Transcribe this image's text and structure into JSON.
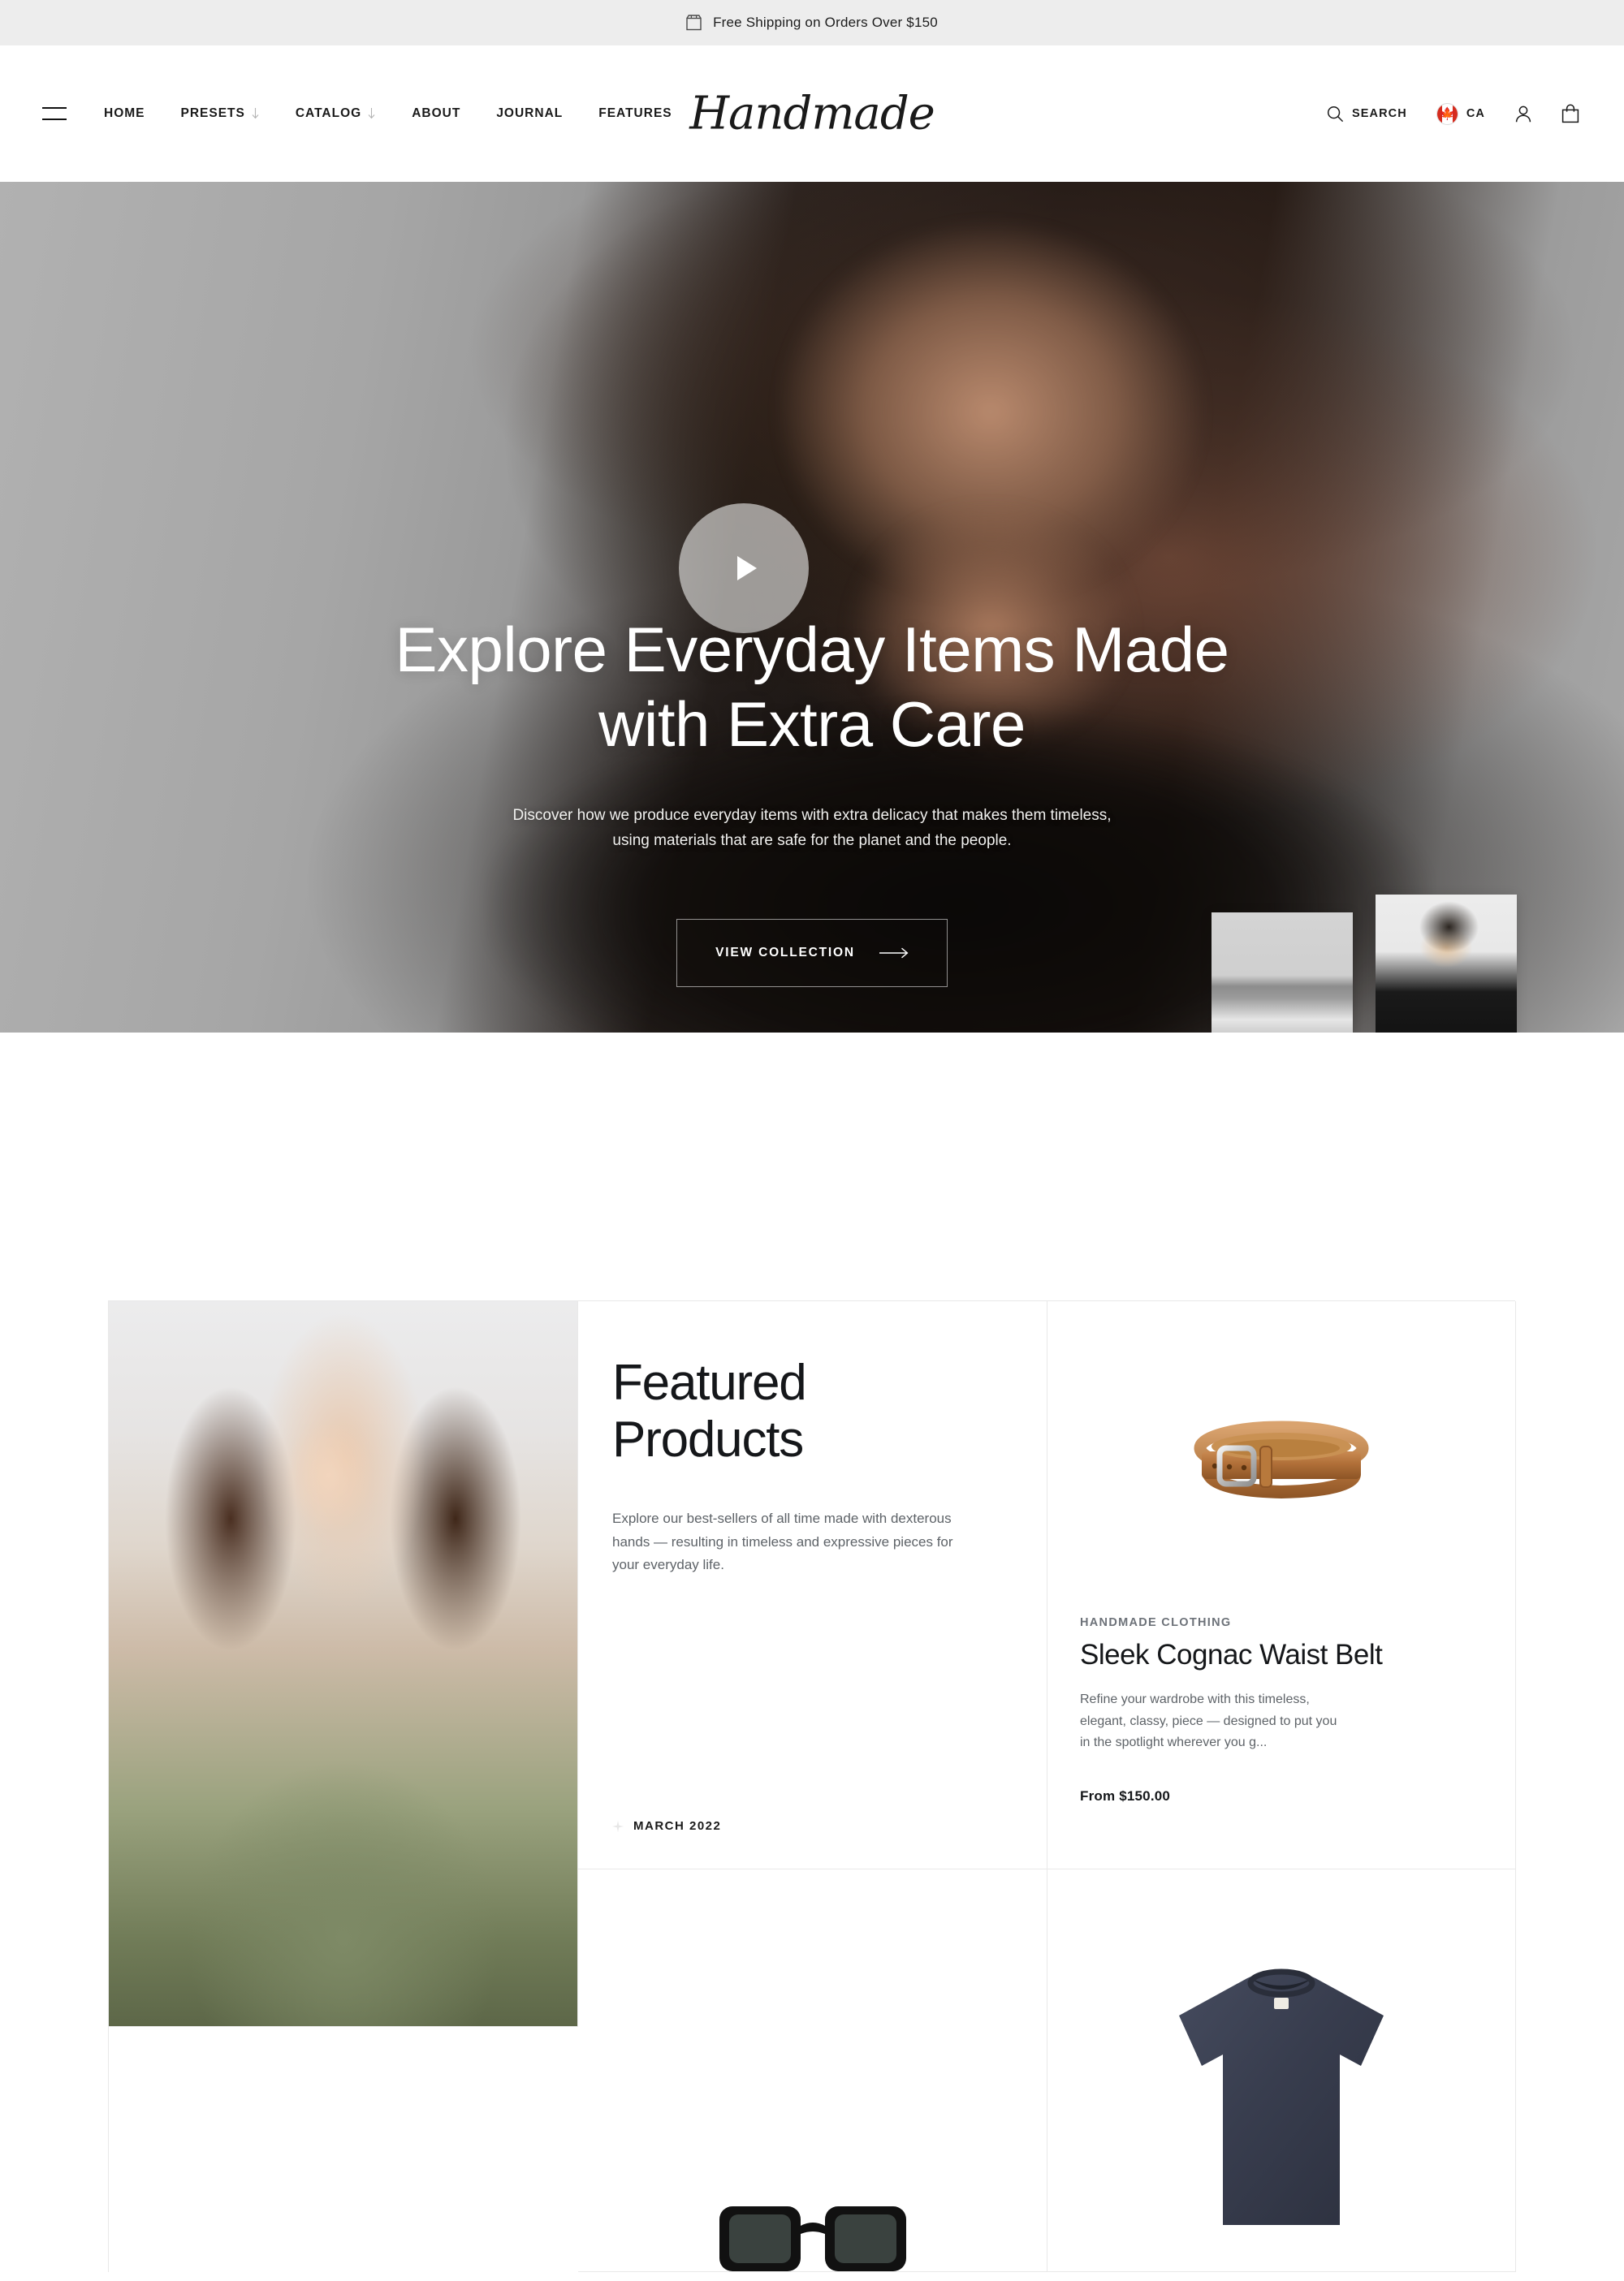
{
  "announcement": {
    "icon": "package-icon",
    "text": "Free Shipping on Orders Over $150"
  },
  "header": {
    "menu_icon": "hamburger-icon",
    "logo": "Handmade",
    "nav": [
      {
        "label": "HOME",
        "has_caret": false
      },
      {
        "label": "PRESETS",
        "has_caret": true
      },
      {
        "label": "CATALOG",
        "has_caret": true
      },
      {
        "label": "ABOUT",
        "has_caret": false
      },
      {
        "label": "JOURNAL",
        "has_caret": false
      },
      {
        "label": "FEATURES",
        "has_caret": false
      }
    ],
    "search_label": "SEARCH",
    "search_icon": "search-icon",
    "country_code": "CA",
    "country_flag_icon": "canada-flag-icon",
    "account_icon": "user-icon",
    "cart_icon": "shopping-bag-icon"
  },
  "hero": {
    "play_icon": "play-icon",
    "title_line1": "Explore Everyday Items Made",
    "title_line2": "with Extra Care",
    "subtitle": "Discover how we produce everyday items with extra delicacy that makes them timeless, using materials that are safe for the planet and the people.",
    "cta_label": "VIEW COLLECTION",
    "cta_icon": "arrow-right-icon",
    "thumbnails": [
      {
        "name": "seascape-thumbnail"
      },
      {
        "name": "model-sunglasses-thumbnail"
      }
    ]
  },
  "featured": {
    "title_line1": "Featured",
    "title_line2": "Products",
    "description": "Explore our best-sellers of all time made with dexterous hands — resulting in timeless and expressive pieces for your everyday life.",
    "date_label": "MARCH 2022",
    "date_icon": "sparkle-icon",
    "product": {
      "vendor": "HANDMADE CLOTHING",
      "name": "Sleek Cognac Waist Belt",
      "description": "Refine your wardrobe with this timeless, elegant, classy, piece — designed to put you in the spotlight wherever you g...",
      "price": "From $150.00",
      "image": "cognac-leather-belt"
    },
    "model_image": "model-olive-coat",
    "bottom_left_image": "black-sunglasses",
    "bottom_mid_image": "navy-tshirt"
  },
  "colors": {
    "announcement_bg": "#ededed",
    "text_primary": "#15171a",
    "text_muted": "#5e6368",
    "flag_red": "#d52b1e",
    "border": "#e9e9e9"
  }
}
